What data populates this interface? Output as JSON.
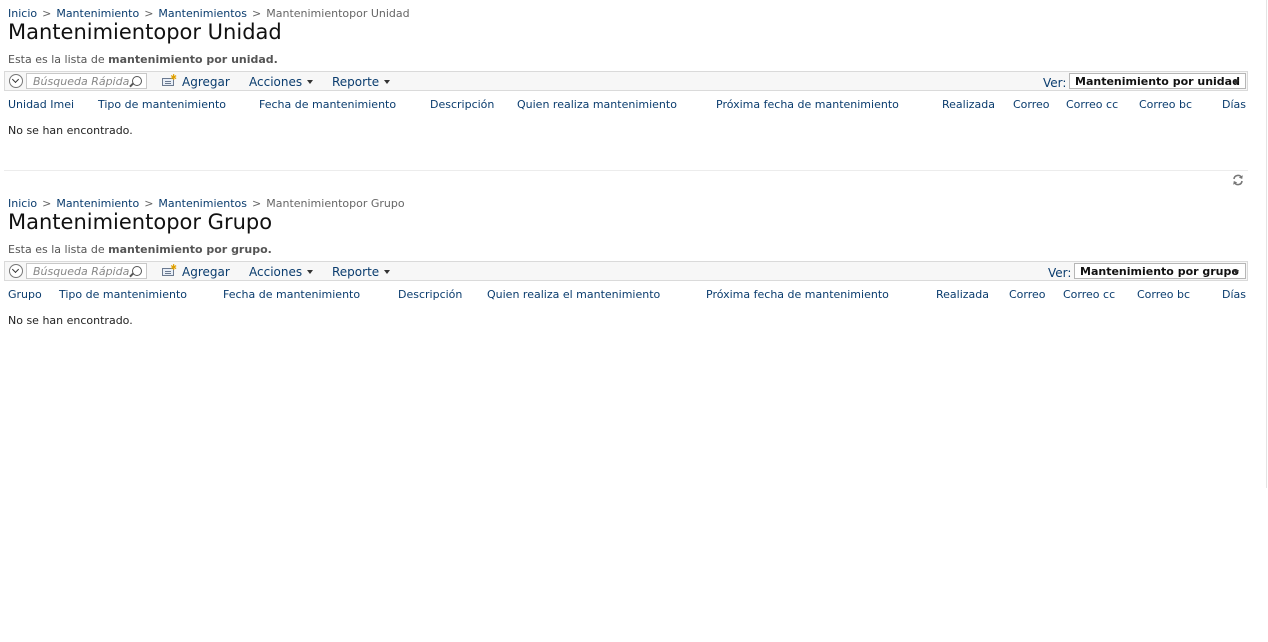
{
  "unidad": {
    "breadcrumb": {
      "inicio": "Inicio",
      "sep": ">",
      "mantenimiento": "Mantenimiento",
      "mantenimientos": "Mantenimientos",
      "current": "Mantenimientopor Unidad"
    },
    "title": "Mantenimientopor Unidad",
    "description_prefix": "Esta es la lista de",
    "description_bold": "mantenimiento por unidad.",
    "toolbar": {
      "search_placeholder": "Búsqueda Rápida",
      "add_label": "Agregar",
      "actions_label": "Acciones",
      "report_label": "Reporte",
      "view_label": "Ver:",
      "view_value": "Mantenimiento por unidad"
    },
    "columns": [
      "Unidad Imei",
      "Tipo de mantenimiento",
      "Fecha de mantenimiento",
      "Descripción",
      "Quien realiza mantenimiento",
      "Próxima fecha de mantenimiento",
      "Realizada",
      "Correo",
      "Correo cc",
      "Correo bc",
      "Días"
    ],
    "empty_message": "No se han encontrado."
  },
  "grupo": {
    "breadcrumb": {
      "inicio": "Inicio",
      "sep": ">",
      "mantenimiento": "Mantenimiento",
      "mantenimientos": "Mantenimientos",
      "current": "Mantenimientopor Grupo"
    },
    "title": "Mantenimientopor Grupo",
    "description_prefix": "Esta es la lista de",
    "description_bold": "mantenimiento por grupo.",
    "toolbar": {
      "search_placeholder": "Búsqueda Rápida",
      "add_label": "Agregar",
      "actions_label": "Acciones",
      "report_label": "Reporte",
      "view_label": "Ver:",
      "view_value": "Mantenimiento por grupo"
    },
    "columns": [
      "Grupo",
      "Tipo de mantenimiento",
      "Fecha de mantenimiento",
      "Descripción",
      "Quien realiza el mantenimiento",
      "Próxima fecha de mantenimiento",
      "Realizada",
      "Correo",
      "Correo cc",
      "Correo bc",
      "Días"
    ],
    "empty_message": "No se han encontrado."
  },
  "icons": {
    "refresh": "refresh-icon",
    "search": "search-icon",
    "add": "add-record-icon",
    "toggle": "chevron-down-circle-icon"
  },
  "colors": {
    "link": "#0a3c6e",
    "toolbar_bg": "#f7f7f7"
  }
}
